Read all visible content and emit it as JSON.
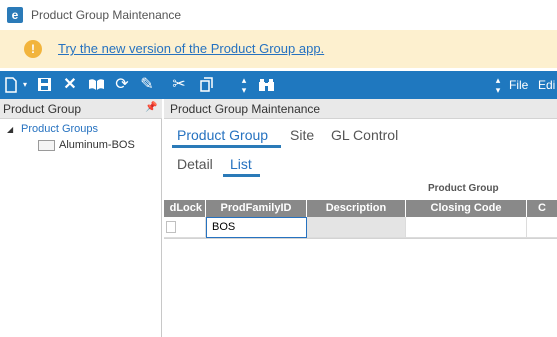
{
  "window": {
    "logo_letter": "e",
    "title": "Product Group Maintenance"
  },
  "banner": {
    "icon": "!",
    "link_text": "Try the new version of the Product Group app."
  },
  "toolbar": {
    "menu_file": "File",
    "menu_edit": "Edi",
    "icons": [
      "new-icon",
      "save-icon",
      "delete-icon",
      "book-icon",
      "refresh-icon",
      "clear-icon",
      "cut-icon",
      "copy-icon",
      "binoculars-icon"
    ]
  },
  "left_pane": {
    "title": "Product Group",
    "tree_root": "Product Groups",
    "tree_children": [
      "Aluminum-BOS"
    ]
  },
  "main_pane": {
    "title": "Product Group Maintenance",
    "tabs": [
      "Product Group",
      "Site",
      "GL Control"
    ],
    "active_tab": "Product Group",
    "subtabs": [
      "Detail",
      "List"
    ],
    "active_subtab": "List",
    "group_header": "Product Group",
    "columns": [
      "dLock",
      "ProdFamilyID",
      "Description",
      "Closing Code",
      "C"
    ],
    "rows": [
      {
        "lock": "",
        "prod_family_id": "BOS",
        "description": "",
        "closing_code": ""
      }
    ]
  },
  "colors": {
    "accent": "#1f78bf",
    "link": "#2672c0",
    "banner_bg": "#fdf0cf",
    "warn": "#f2b43c",
    "grid_header": "#898989"
  }
}
